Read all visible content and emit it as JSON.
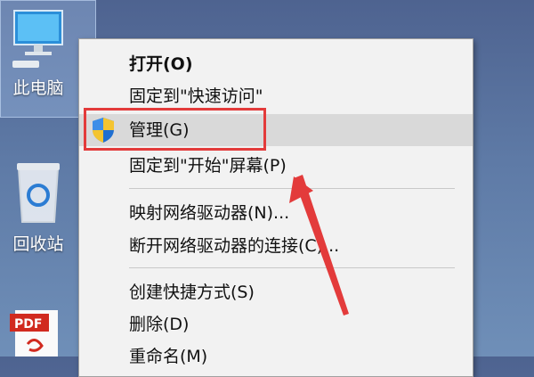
{
  "desktop": {
    "computer_label": "此电脑",
    "recycle_label": "回收站",
    "pdf_label": "PDF"
  },
  "menu": {
    "items": [
      {
        "label": "打开(O)",
        "bold": true
      },
      {
        "label": "固定到\"快速访问\""
      },
      {
        "label": "管理(G)",
        "highlighted": true,
        "icon": "uac-shield-icon"
      },
      {
        "label": "固定到\"开始\"屏幕(P)"
      },
      {
        "label": "映射网络驱动器(N)..."
      },
      {
        "label": "断开网络驱动器的连接(C)..."
      },
      {
        "label": "创建快捷方式(S)"
      },
      {
        "label": "删除(D)"
      },
      {
        "label": "重命名(M)"
      }
    ]
  },
  "annotation": {
    "box_color": "#e33b3b",
    "arrow_color": "#e33b3b"
  }
}
